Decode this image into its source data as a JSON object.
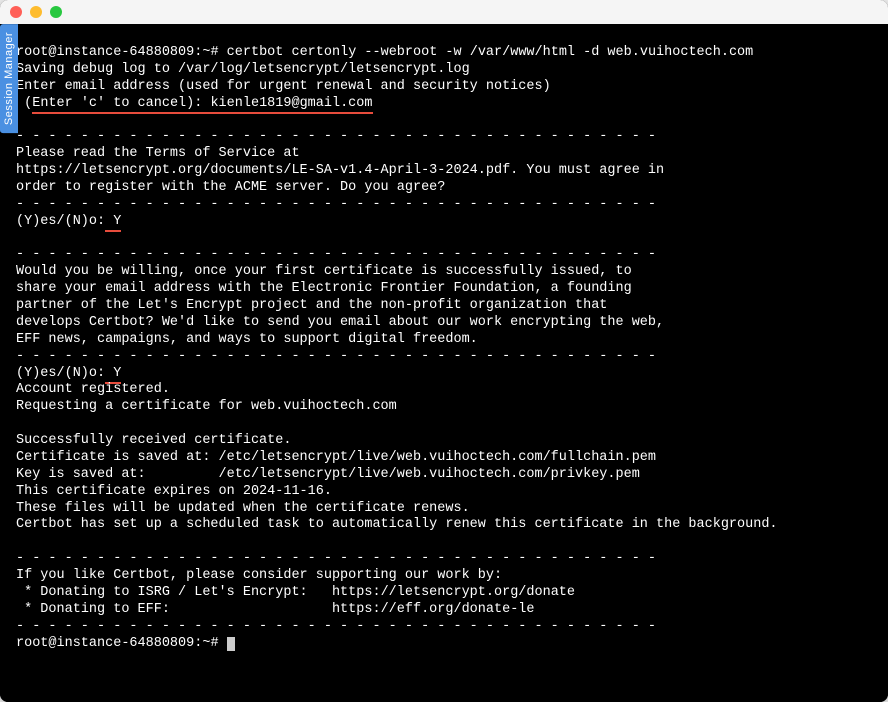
{
  "window": {
    "session_tab": "Session Manager"
  },
  "term": {
    "prompt1_user": "root@instance-64880809",
    "prompt1_path": "~",
    "prompt1_hash": "#",
    "cmd1": "certbot certonly --webroot -w /var/www/html -d web.vuihoctech.com",
    "l_save": "Saving debug log to /var/log/letsencrypt/letsencrypt.log",
    "l_email_prompt": "Enter email address (used for urgent renewal and security notices)",
    "l_cancel_prefix_space": " (",
    "l_cancel_text": "Enter 'c' to cancel):",
    "l_email_value": " kienle1819@gmail.com",
    "dash_row": "- - - - - - - - - - - - - - - - - - - - - - - - - - - - - - - - - - - - - - - -",
    "tos_l1": "Please read the Terms of Service at",
    "tos_l2": "https://letsencrypt.org/documents/LE-SA-v1.4-April-3-2024.pdf. You must agree in",
    "tos_l3": "order to register with the ACME server. Do you agree?",
    "yn1_label": "(Y)es/(N)o:",
    "yn1_val": " Y",
    "eff_l1": "Would you be willing, once your first certificate is successfully issued, to",
    "eff_l2": "share your email address with the Electronic Frontier Foundation, a founding",
    "eff_l3": "partner of the Let's Encrypt project and the non-profit organization that",
    "eff_l4": "develops Certbot? We'd like to send you email about our work encrypting the web,",
    "eff_l5": "EFF news, campaigns, and ways to support digital freedom.",
    "yn2_label": "(Y)es/(N)o:",
    "yn2_val": " Y",
    "acct_reg": "Account registered.",
    "req_cert": "Requesting a certificate for web.vuihoctech.com",
    "succ_l1": "Successfully received certificate.",
    "succ_l2": "Certificate is saved at: /etc/letsencrypt/live/web.vuihoctech.com/fullchain.pem",
    "succ_l3": "Key is saved at:         /etc/letsencrypt/live/web.vuihoctech.com/privkey.pem",
    "succ_l4": "This certificate expires on 2024-11-16.",
    "succ_l5": "These files will be updated when the certificate renews.",
    "succ_l6": "Certbot has set up a scheduled task to automatically renew this certificate in the background.",
    "sup_l1": "If you like Certbot, please consider supporting our work by:",
    "sup_l2": " * Donating to ISRG / Let's Encrypt:   https://letsencrypt.org/donate",
    "sup_l3": " * Donating to EFF:                    https://eff.org/donate-le",
    "prompt2_user": "root@instance-64880809",
    "prompt2_path": "~",
    "prompt2_hash": "#"
  }
}
